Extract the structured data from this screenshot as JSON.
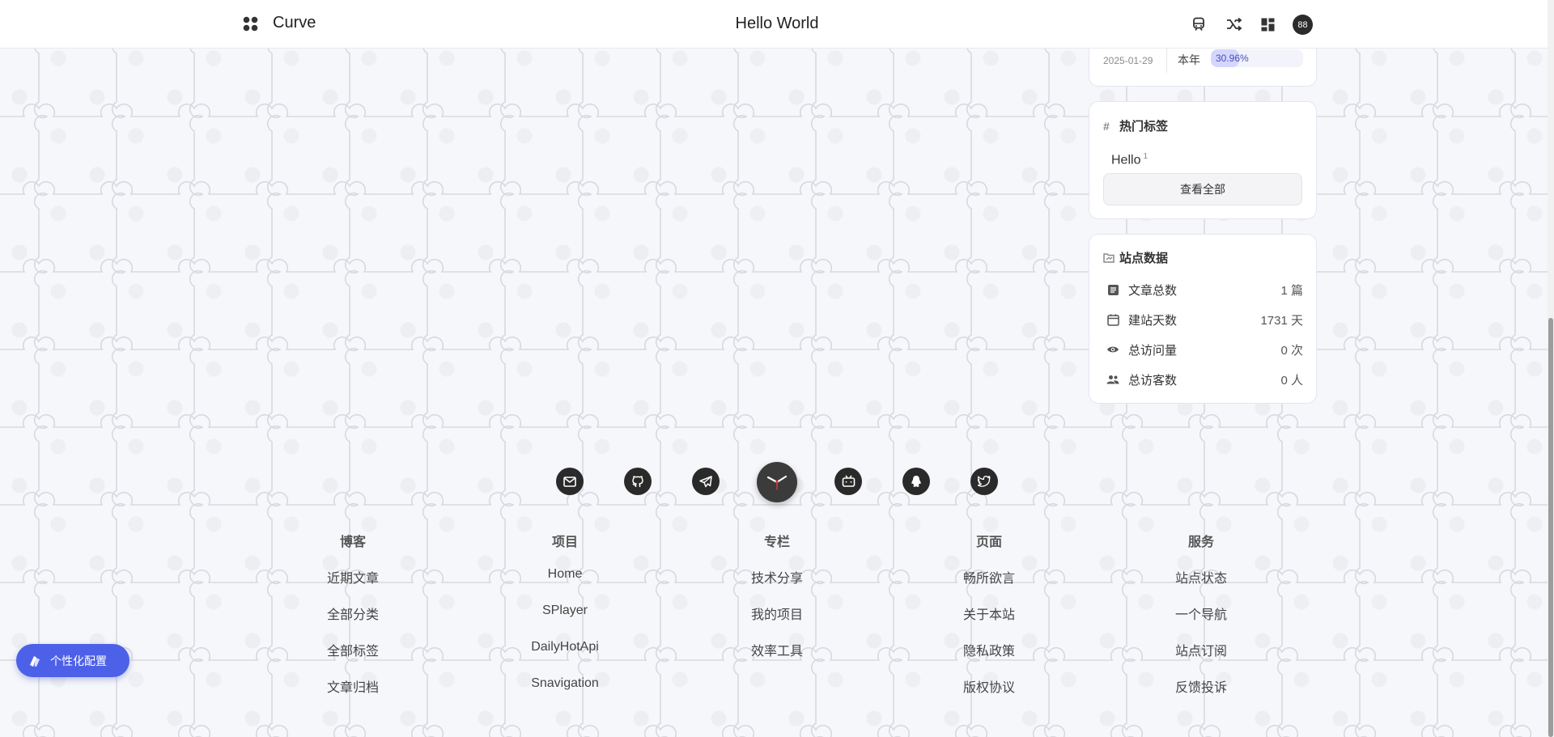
{
  "header": {
    "brand": "Curve",
    "title": "Hello World",
    "avatar_text": "88",
    "icons": [
      "subway-icon",
      "shuffle-icon",
      "dashboard-icon"
    ]
  },
  "sidebar": {
    "progress": {
      "date": "2025-01-29",
      "label": "本年",
      "percent_text": "30.96%",
      "percent": 30.96
    },
    "tags": {
      "title": "热门标签",
      "items": [
        {
          "name": "Hello",
          "count": "1"
        }
      ],
      "view_all": "查看全部"
    },
    "stats": {
      "title": "站点数据",
      "rows": [
        {
          "label": "文章总数",
          "value": "1 篇",
          "icon": "article-icon"
        },
        {
          "label": "建站天数",
          "value": "1731 天",
          "icon": "calendar-icon"
        },
        {
          "label": "总访问量",
          "value": "0 次",
          "icon": "eye-icon"
        },
        {
          "label": "总访客数",
          "value": "0 人",
          "icon": "visitors-icon"
        }
      ]
    }
  },
  "social": [
    "email-icon",
    "github-icon",
    "telegram-icon",
    "clock-icon",
    "bilibili-icon",
    "qq-icon",
    "twitter-icon"
  ],
  "footer": {
    "columns": [
      {
        "title": "博客",
        "links": [
          "近期文章",
          "全部分类",
          "全部标签",
          "文章归档"
        ]
      },
      {
        "title": "项目",
        "links": [
          "Home",
          "SPlayer",
          "DailyHotApi",
          "Snavigation"
        ]
      },
      {
        "title": "专栏",
        "links": [
          "技术分享",
          "我的项目",
          "效率工具"
        ]
      },
      {
        "title": "页面",
        "links": [
          "畅所欲言",
          "关于本站",
          "隐私政策",
          "版权协议"
        ]
      },
      {
        "title": "服务",
        "links": [
          "站点状态",
          "一个导航",
          "站点订阅",
          "反馈投诉"
        ]
      }
    ]
  },
  "personalize_button": "个性化配置",
  "colors": {
    "accent": "#4c60e8",
    "progress_fill": "#d4d7fb",
    "background": "#f6f7fb"
  }
}
